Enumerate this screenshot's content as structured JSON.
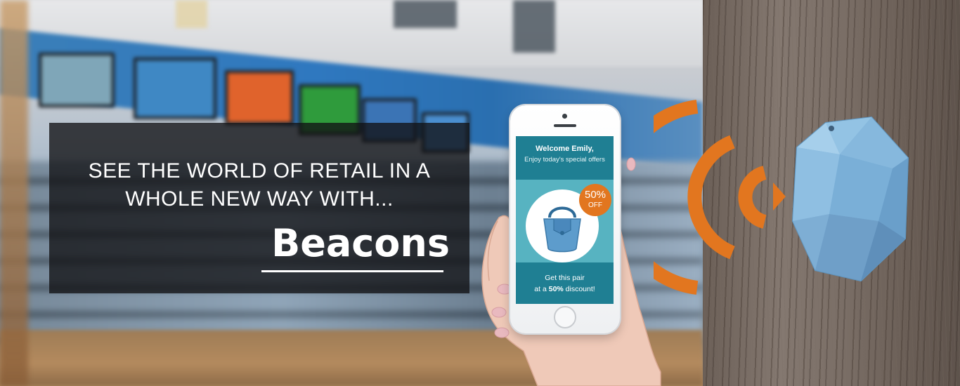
{
  "banner": {
    "headline_line_1": "SEE THE WORLD OF RETAIL IN A",
    "headline_line_2": "WHOLE NEW WAY WITH...",
    "brand_word": "Beacons"
  },
  "phone_screen": {
    "welcome_text": "Welcome Emily,",
    "subtitle": "Enjoy today's special offers",
    "discount_percent": "50%",
    "discount_label": "OFF",
    "cta_line_1": "Get this pair",
    "cta_line_2_prefix": "at a",
    "cta_line_2_bold": "50%",
    "cta_line_2_suffix": "discount!"
  },
  "colors": {
    "signal_orange": "#E2761F",
    "beacon_blue": "#7FB3DA",
    "screen_teal": "#1F7F93",
    "offer_panel": "#57B3C1",
    "overlay_box": "#121214"
  },
  "icons": {
    "signal": "wireless-signal-icon",
    "beacon": "beacon-device-icon",
    "bag": "handbag-icon"
  }
}
